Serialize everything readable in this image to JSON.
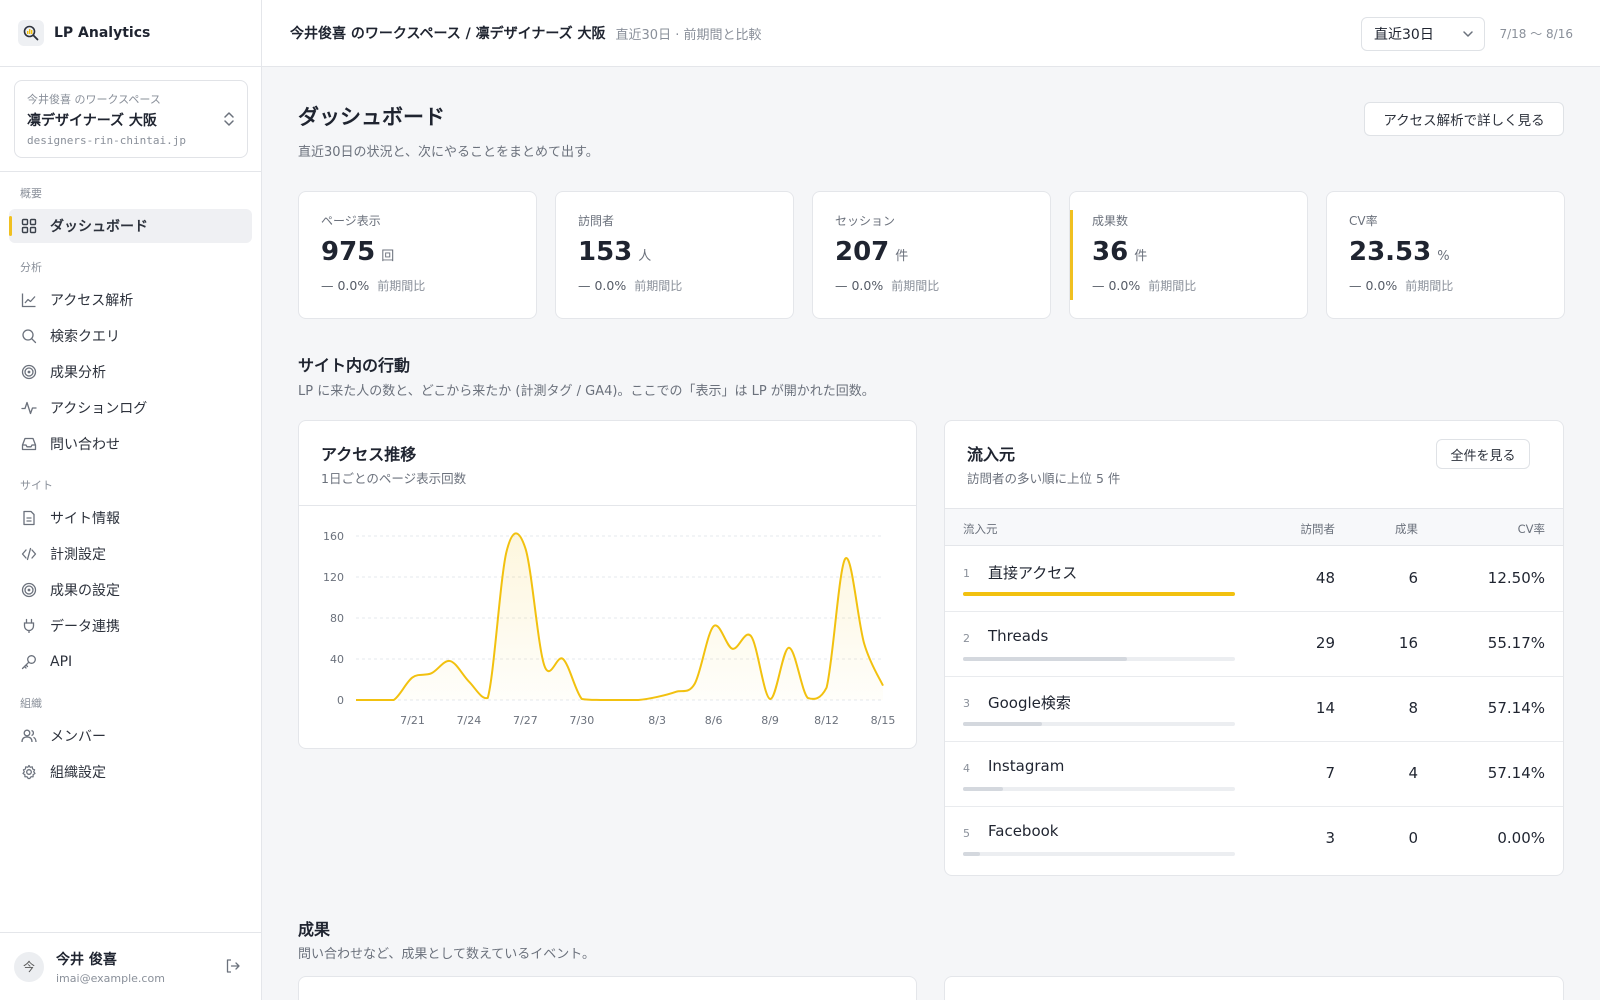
{
  "brand": {
    "name": "LP Analytics"
  },
  "workspace": {
    "owner": "今井俊喜 のワークスペース",
    "name": "凛デザイナーズ 大阪",
    "domain": "designers-rin-chintai.jp"
  },
  "nav": {
    "groups": [
      {
        "label": "概要",
        "items": [
          {
            "label": "ダッシュボード",
            "icon": "grid-icon"
          }
        ]
      },
      {
        "label": "分析",
        "items": [
          {
            "label": "アクセス解析",
            "icon": "line-chart-icon"
          },
          {
            "label": "検索クエリ",
            "icon": "search-icon"
          },
          {
            "label": "成果分析",
            "icon": "target-icon"
          },
          {
            "label": "アクションログ",
            "icon": "activity-icon"
          },
          {
            "label": "問い合わせ",
            "icon": "inbox-icon"
          }
        ]
      },
      {
        "label": "サイト",
        "items": [
          {
            "label": "サイト情報",
            "icon": "document-icon"
          },
          {
            "label": "計測設定",
            "icon": "code-icon"
          },
          {
            "label": "成果の設定",
            "icon": "target-icon"
          },
          {
            "label": "データ連携",
            "icon": "plug-icon"
          },
          {
            "label": "API",
            "icon": "key-icon"
          }
        ]
      },
      {
        "label": "組織",
        "items": [
          {
            "label": "メンバー",
            "icon": "users-icon"
          },
          {
            "label": "組織設定",
            "icon": "gear-icon"
          }
        ]
      }
    ]
  },
  "user": {
    "initial": "今",
    "name": "今井 俊喜",
    "email": "imai@example.com"
  },
  "topbar": {
    "breadcrumb": "今井俊喜 のワークスペース / 凛デザイナーズ 大阪",
    "subtitle": "直近30日 · 前期間と比較",
    "period": "直近30日",
    "range": "7/18 〜 8/16"
  },
  "page": {
    "title": "ダッシュボード",
    "description": "直近30日の状況と、次にやることをまとめて出す。",
    "detail_button": "アクセス解析で詳しく見る"
  },
  "kpis": [
    {
      "label": "ページ表示",
      "value": "975",
      "unit": "回",
      "delta": "0.0%",
      "compare": "前期間比"
    },
    {
      "label": "訪問者",
      "value": "153",
      "unit": "人",
      "delta": "0.0%",
      "compare": "前期間比"
    },
    {
      "label": "セッション",
      "value": "207",
      "unit": "件",
      "delta": "0.0%",
      "compare": "前期間比"
    },
    {
      "label": "成果数",
      "value": "36",
      "unit": "件",
      "delta": "0.0%",
      "compare": "前期間比"
    },
    {
      "label": "CV率",
      "value": "23.53",
      "unit": "%",
      "delta": "0.0%",
      "compare": "前期間比"
    }
  ],
  "behavior": {
    "title": "サイト内の行動",
    "description": "LP に来た人の数と、どこから来たか (計測タグ / GA4)。ここでの「表示」は LP が開かれた回数。"
  },
  "access_chart": {
    "title": "アクセス推移",
    "subtitle": "1日ごとのページ表示回数"
  },
  "chart_data": {
    "type": "line",
    "title": "アクセス推移",
    "x": [
      "7/18",
      "7/19",
      "7/20",
      "7/21",
      "7/22",
      "7/23",
      "7/24",
      "7/25",
      "7/26",
      "7/27",
      "7/28",
      "7/29",
      "7/30",
      "7/31",
      "8/1",
      "8/2",
      "8/3",
      "8/4",
      "8/5",
      "8/6",
      "8/7",
      "8/8",
      "8/9",
      "8/10",
      "8/11",
      "8/12",
      "8/13",
      "8/14",
      "8/15"
    ],
    "series": [
      {
        "values": [
          0,
          0,
          0,
          22,
          26,
          38,
          18,
          2,
          145,
          148,
          34,
          40,
          1,
          0,
          0,
          0,
          3,
          8,
          16,
          72,
          50,
          62,
          1,
          51,
          2,
          12,
          138,
          55,
          14
        ]
      }
    ],
    "xticks": [
      "7/21",
      "7/24",
      "7/27",
      "7/30",
      "8/3",
      "8/6",
      "8/9",
      "8/12",
      "8/15"
    ],
    "yticks": [
      0,
      40,
      80,
      120,
      160
    ],
    "ylim": [
      0,
      160
    ],
    "grid": true,
    "color": "#f2c10f"
  },
  "sources": {
    "title": "流入元",
    "subtitle": "訪問者の多い順に上位 5 件",
    "view_all": "全件を見る",
    "headers": {
      "source": "流入元",
      "visitors": "訪問者",
      "conversions": "成果",
      "cvr": "CV率"
    },
    "rows": [
      {
        "rank": "1",
        "name": "直接アクセス",
        "visitors": "48",
        "conversions": "6",
        "cvr": "12.50%",
        "share": 1.0
      },
      {
        "rank": "2",
        "name": "Threads",
        "visitors": "29",
        "conversions": "16",
        "cvr": "55.17%",
        "share": 0.604
      },
      {
        "rank": "3",
        "name": "Google検索",
        "visitors": "14",
        "conversions": "8",
        "cvr": "57.14%",
        "share": 0.292
      },
      {
        "rank": "4",
        "name": "Instagram",
        "visitors": "7",
        "conversions": "4",
        "cvr": "57.14%",
        "share": 0.146
      },
      {
        "rank": "5",
        "name": "Facebook",
        "visitors": "3",
        "conversions": "0",
        "cvr": "0.00%",
        "share": 0.063
      }
    ],
    "colors": {
      "top": "#f2c10f",
      "other": "#d4d8de"
    }
  },
  "results": {
    "title": "成果",
    "description": "問い合わせなど、成果として数えているイベント。"
  }
}
